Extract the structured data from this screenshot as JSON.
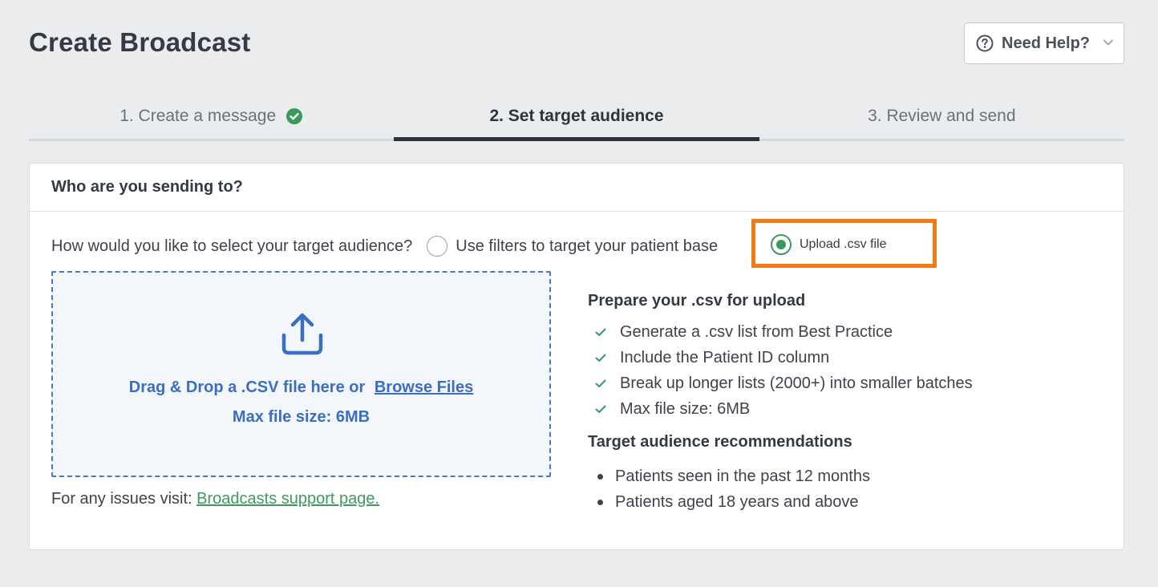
{
  "page": {
    "title": "Create Broadcast",
    "help_label": "Need Help?"
  },
  "stepper": {
    "steps": [
      {
        "label": "1. Create a message",
        "state": "complete"
      },
      {
        "label": "2. Set target audience",
        "state": "active"
      },
      {
        "label": "3. Review and send",
        "state": "upcoming"
      }
    ]
  },
  "card": {
    "header": "Who are you sending to?",
    "question": "How would you like to select your target audience?",
    "options": [
      {
        "label": "Use filters to target your patient base",
        "selected": false
      },
      {
        "label": "Upload .csv file",
        "selected": true
      }
    ],
    "dropzone": {
      "drag_text": "Drag & Drop a .CSV file here",
      "or_text": "or",
      "browse_text": "Browse Files",
      "max_text": "Max file size: 6MB"
    },
    "issues": {
      "prefix": "For any issues visit:",
      "link": "Broadcasts support page."
    },
    "prepare": {
      "heading": "Prepare your .csv for upload",
      "items": [
        "Generate a .csv list from Best Practice",
        "Include the Patient ID column",
        "Break up longer lists (2000+) into smaller batches",
        "Max file size: 6MB"
      ]
    },
    "recommendations": {
      "heading": "Target audience recommendations",
      "items": [
        "Patients seen in the past 12 months",
        "Patients aged 18 years and above"
      ]
    }
  },
  "colors": {
    "accent_green": "#3a9a5b",
    "link_blue": "#3b6ec1",
    "highlight_orange": "#f47b12"
  }
}
